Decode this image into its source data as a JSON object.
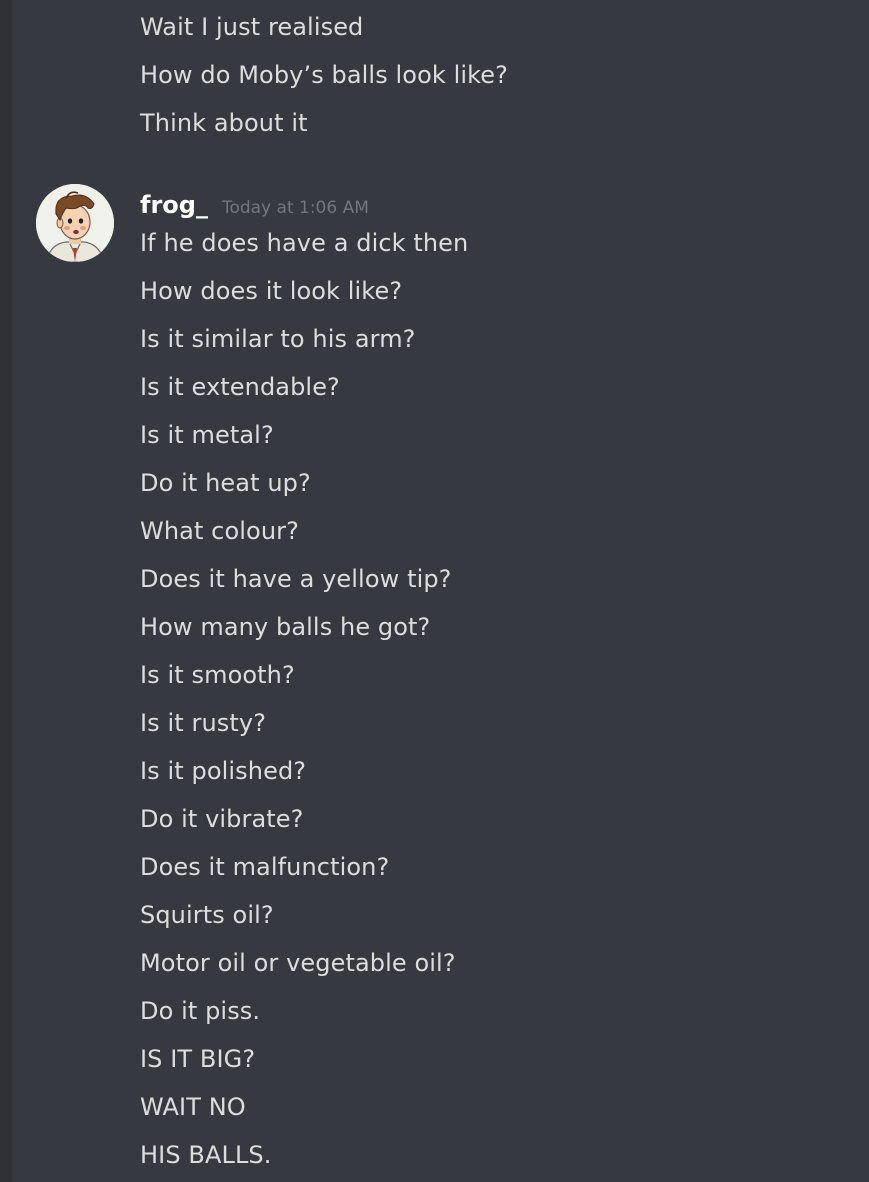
{
  "previous_group": {
    "lines": [
      "Wait I just realised",
      "How do Moby’s balls look like?",
      "Think about it"
    ]
  },
  "message": {
    "author": "frog_",
    "timestamp": "Today at 1:06 AM",
    "avatar_icon": "cartoon-man-avatar-icon",
    "lines": [
      "If he does have a dick then",
      "How does it look like?",
      "Is it similar to his arm?",
      "Is it extendable?",
      "Is it metal?",
      "Do it heat up?",
      "What colour?",
      "Does it have a yellow tip?",
      "How many balls he got?",
      "Is it smooth?",
      "Is it rusty?",
      "Is it polished?",
      "Do it vibrate?",
      "Does it malfunction?",
      "Squirts oil?",
      "Motor oil or vegetable oil?",
      "Do it piss.",
      "IS IT BIG?",
      "WAIT NO",
      "HIS BALLS."
    ]
  },
  "colors": {
    "background": "#36393f",
    "message_text": "#dcddde",
    "author_name": "#ffffff",
    "timestamp": "#72767d"
  }
}
